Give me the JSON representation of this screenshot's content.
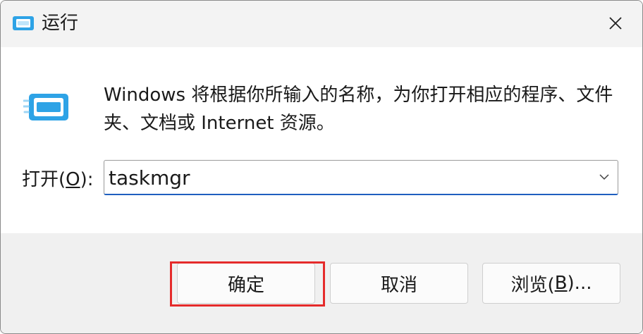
{
  "window": {
    "title": "运行",
    "title_icon": "run-dialog-icon",
    "close_icon": "close-icon"
  },
  "content": {
    "icon": "run-dialog-icon",
    "description": "Windows 将根据你所输入的名称，为你打开相应的程序、文件夹、文档或 Internet 资源。",
    "open_label_prefix": "打开(",
    "open_label_accel": "O",
    "open_label_suffix": "):",
    "input_value": "taskmgr",
    "dropdown_icon": "chevron-down-icon"
  },
  "buttons": {
    "ok": "确定",
    "cancel": "取消",
    "browse_prefix": "浏览(",
    "browse_accel": "B",
    "browse_suffix": ")..."
  },
  "colors": {
    "accent": "#1f5fbf",
    "highlight": "#e52b2b",
    "icon_blue": "#2ea3e6"
  }
}
